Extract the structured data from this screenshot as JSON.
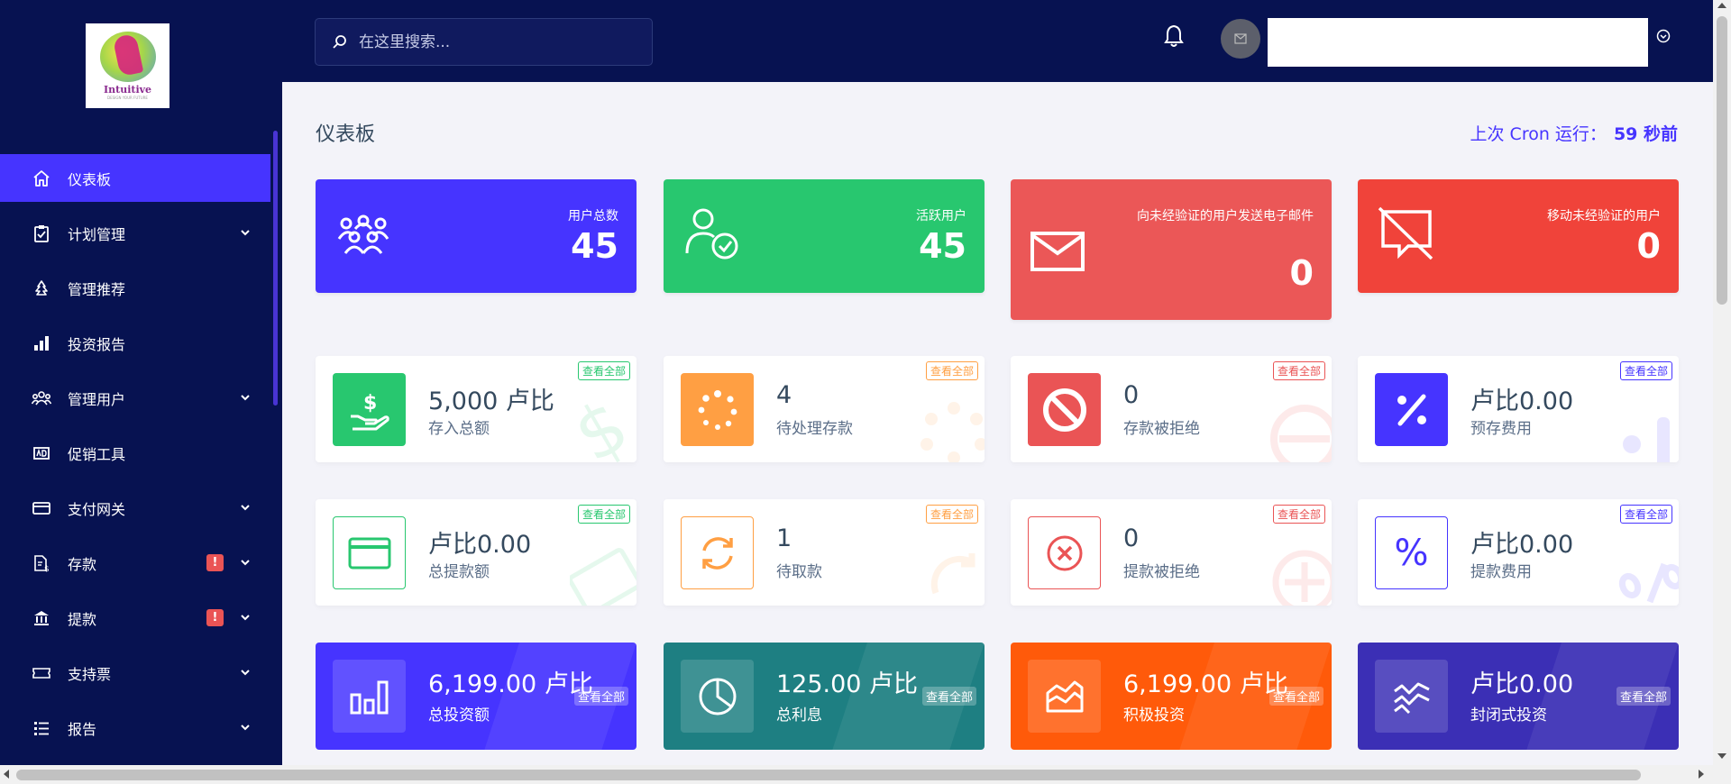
{
  "brand": {
    "logo_text": "Intuitive",
    "logo_tagline": "DESIGN YOUR FUTURE"
  },
  "sidebar": {
    "items": [
      {
        "label": "仪表板",
        "icon": "home-icon",
        "active": true,
        "has_children": false,
        "alert": ""
      },
      {
        "label": "计划管理",
        "icon": "clipboard-icon",
        "active": false,
        "has_children": true,
        "alert": ""
      },
      {
        "label": "管理推荐",
        "icon": "tree-icon",
        "active": false,
        "has_children": false,
        "alert": ""
      },
      {
        "label": "投资报告",
        "icon": "bar-chart-icon",
        "active": false,
        "has_children": false,
        "alert": ""
      },
      {
        "label": "管理用户",
        "icon": "users-icon",
        "active": false,
        "has_children": true,
        "alert": ""
      },
      {
        "label": "促销工具",
        "icon": "ad-icon",
        "active": false,
        "has_children": false,
        "alert": ""
      },
      {
        "label": "支付网关",
        "icon": "credit-card-icon",
        "active": false,
        "has_children": true,
        "alert": ""
      },
      {
        "label": "存款",
        "icon": "file-dollar-icon",
        "active": false,
        "has_children": true,
        "alert": "!"
      },
      {
        "label": "提款",
        "icon": "bank-icon",
        "active": false,
        "has_children": true,
        "alert": "!"
      },
      {
        "label": "支持票",
        "icon": "ticket-icon",
        "active": false,
        "has_children": true,
        "alert": ""
      },
      {
        "label": "报告",
        "icon": "list-icon",
        "active": false,
        "has_children": true,
        "alert": ""
      }
    ]
  },
  "topbar": {
    "search_placeholder": "在这里搜索..."
  },
  "page": {
    "title": "仪表板",
    "cron_label": "上次 Cron 运行：",
    "cron_value": "59 秒前"
  },
  "stats": [
    {
      "label": "用户总数",
      "value": "45",
      "color": "#4634ff",
      "icon": "users-group-icon"
    },
    {
      "label": "活跃用户",
      "value": "45",
      "color": "#28c76f",
      "icon": "user-check-icon"
    },
    {
      "label": "向未经验证的用户发送电子邮件",
      "value": "0",
      "color": "#eb5757",
      "icon": "envelope-icon"
    },
    {
      "label": "移动未经验证的用户",
      "value": "0",
      "color": "#f0433a",
      "icon": "comment-slash-icon"
    }
  ],
  "deposits": [
    {
      "value": "5,000 卢比",
      "label": "存入总额",
      "badge": "查看全部",
      "color": "#28c76f",
      "icon": "hand-dollar-icon"
    },
    {
      "value": "4",
      "label": "待处理存款",
      "badge": "查看全部",
      "color": "#ff9f43",
      "icon": "spinner-icon"
    },
    {
      "value": "0",
      "label": "存款被拒绝",
      "badge": "查看全部",
      "color": "#ea5455",
      "icon": "ban-icon"
    },
    {
      "value": "卢比0.00",
      "label": "预存费用",
      "badge": "查看全部",
      "color": "#4634ff",
      "icon": "percent-icon"
    }
  ],
  "withdrawals": [
    {
      "value": "卢比0.00",
      "label": "总提款额",
      "badge": "查看全部",
      "color": "#28c76f",
      "icon": "credit-card-icon"
    },
    {
      "value": "1",
      "label": "待取款",
      "badge": "查看全部",
      "color": "#ff9f43",
      "icon": "sync-icon"
    },
    {
      "value": "0",
      "label": "提款被拒绝",
      "badge": "查看全部",
      "color": "#ea5455",
      "icon": "times-circle-icon"
    },
    {
      "value": "卢比0.00",
      "label": "提款费用",
      "badge": "查看全部",
      "color": "#4634ff",
      "icon": "percent-icon"
    }
  ],
  "investments": [
    {
      "value": "6,199.00 卢比",
      "label": "总投资额",
      "badge": "查看全部",
      "color": "#4634ff",
      "icon": "chart-bar-icon"
    },
    {
      "value": "125.00 卢比",
      "label": "总利息",
      "badge": "查看全部",
      "color": "#1e7f82",
      "icon": "chart-pie-icon"
    },
    {
      "value": "6,199.00 卢比",
      "label": "积极投资",
      "badge": "查看全部",
      "color": "#ff5a0a",
      "icon": "chart-area-icon"
    },
    {
      "value": "卢比0.00",
      "label": "封闭式投资",
      "badge": "查看全部",
      "color": "#3b2fb5",
      "icon": "chart-line-icon"
    }
  ]
}
